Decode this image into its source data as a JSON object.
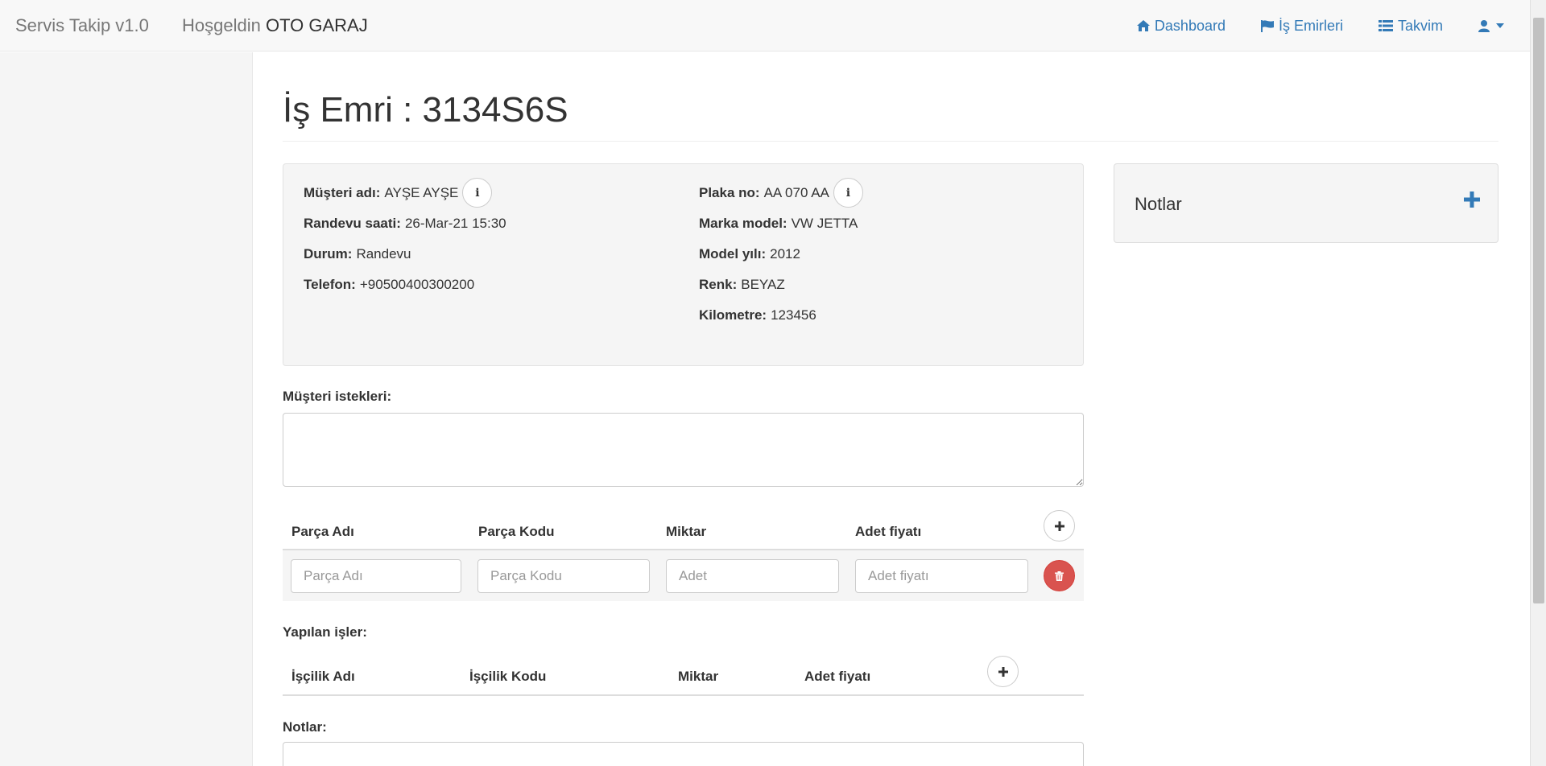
{
  "navbar": {
    "brand": "Servis Takip v1.0",
    "welcome_prefix": "Hoşgeldin",
    "welcome_name": "OTO GARAJ",
    "links": [
      {
        "label": "Dashboard",
        "icon": "home-icon"
      },
      {
        "label": "İş Emirleri",
        "icon": "flag-icon"
      },
      {
        "label": "Takvim",
        "icon": "list-icon"
      }
    ],
    "user_icon": "user-icon"
  },
  "page": {
    "title": "İş Emri : 3134S6S"
  },
  "info": {
    "left": [
      {
        "label": "Müşteri adı:",
        "value": "AYŞE AYŞE"
      },
      {
        "label": "Randevu saati:",
        "value": "26-Mar-21 15:30"
      },
      {
        "label": "Durum:",
        "value": "Randevu"
      },
      {
        "label": "Telefon:",
        "value": "+90500400300200"
      }
    ],
    "right": [
      {
        "label": "Plaka no:",
        "value": "AA 070 AA"
      },
      {
        "label": "Marka model:",
        "value": "VW JETTA"
      },
      {
        "label": "Model yılı:",
        "value": "2012"
      },
      {
        "label": "Renk:",
        "value": "BEYAZ"
      },
      {
        "label": "Kilometre:",
        "value": "123456"
      }
    ]
  },
  "notes_panel": {
    "title": "Notlar"
  },
  "requests": {
    "label": "Müşteri istekleri:",
    "value": ""
  },
  "parts": {
    "headers": [
      "Parça Adı",
      "Parça Kodu",
      "Miktar",
      "Adet fiyatı"
    ],
    "placeholders": {
      "name": "Parça Adı",
      "code": "Parça Kodu",
      "qty": "Adet",
      "price": "Adet fiyatı"
    }
  },
  "labor": {
    "label": "Yapılan işler:",
    "headers": [
      "İşçilik Adı",
      "İşçilik Kodu",
      "Miktar",
      "Adet fiyatı"
    ]
  },
  "notes_field": {
    "label": "Notlar:"
  }
}
